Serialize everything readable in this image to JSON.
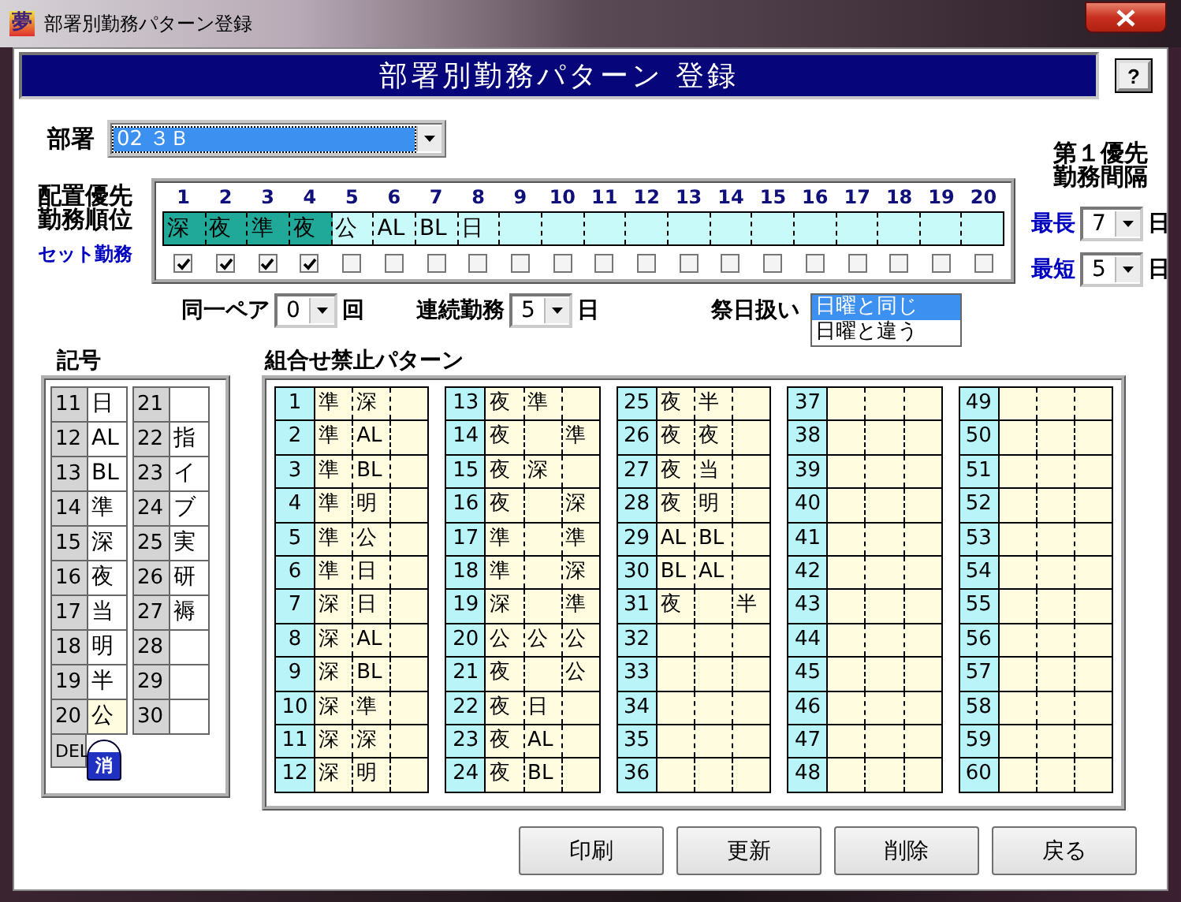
{
  "window": {
    "icon": "夢",
    "title": "部署別勤務パターン登録"
  },
  "header": {
    "title": "部署別勤務パターン 登録",
    "help": "?"
  },
  "department": {
    "label": "部署",
    "value": "02 ３Ｂ"
  },
  "priority": {
    "label_lines": [
      "配置優先",
      "勤務順位"
    ],
    "set_label": "セット勤務",
    "slots": [
      {
        "no": "1",
        "symbol": "深",
        "set": true
      },
      {
        "no": "2",
        "symbol": "夜",
        "set": true
      },
      {
        "no": "3",
        "symbol": "準",
        "set": true
      },
      {
        "no": "4",
        "symbol": "夜",
        "set": true
      },
      {
        "no": "5",
        "symbol": "公",
        "set": false
      },
      {
        "no": "6",
        "symbol": "AL",
        "set": false
      },
      {
        "no": "7",
        "symbol": "BL",
        "set": false
      },
      {
        "no": "8",
        "symbol": "日",
        "set": false
      },
      {
        "no": "9",
        "set": false
      },
      {
        "no": "10",
        "set": false
      },
      {
        "no": "11",
        "set": false
      },
      {
        "no": "12",
        "set": false
      },
      {
        "no": "13",
        "set": false
      },
      {
        "no": "14",
        "set": false
      },
      {
        "no": "15",
        "set": false
      },
      {
        "no": "16",
        "set": false
      },
      {
        "no": "17",
        "set": false
      },
      {
        "no": "18",
        "set": false
      },
      {
        "no": "19",
        "set": false
      },
      {
        "no": "20",
        "set": false
      }
    ]
  },
  "same_pair": {
    "label": "同一ペア",
    "value": "0",
    "unit": "回"
  },
  "consecutive": {
    "label": "連続勤務",
    "value": "5",
    "unit": "日"
  },
  "holiday": {
    "label": "祭日扱い",
    "options": [
      {
        "label": "日曜と同じ",
        "selected": true
      },
      {
        "label": "日曜と違う",
        "selected": false
      }
    ]
  },
  "interval": {
    "title_lines": [
      "第１優先",
      "勤務間隔"
    ],
    "rows": [
      {
        "label": "最長",
        "value": "7",
        "unit": "日"
      },
      {
        "label": "最短",
        "value": "5",
        "unit": "日"
      }
    ]
  },
  "symbols": {
    "title": "記号",
    "items": [
      {
        "no": "11",
        "symbol": "日",
        "selected": false
      },
      {
        "no": "12",
        "symbol": "AL",
        "selected": false
      },
      {
        "no": "13",
        "symbol": "BL",
        "selected": false
      },
      {
        "no": "14",
        "symbol": "準",
        "selected": false
      },
      {
        "no": "15",
        "symbol": "深",
        "selected": false
      },
      {
        "no": "16",
        "symbol": "夜",
        "selected": false
      },
      {
        "no": "17",
        "symbol": "当",
        "selected": false
      },
      {
        "no": "18",
        "symbol": "明",
        "selected": false
      },
      {
        "no": "19",
        "symbol": "半",
        "selected": false
      },
      {
        "no": "20",
        "symbol": "公",
        "selected": true
      },
      {
        "no": "21",
        "selected": false
      },
      {
        "no": "22",
        "symbol": "指",
        "selected": false
      },
      {
        "no": "23",
        "symbol": "イ",
        "selected": false
      },
      {
        "no": "24",
        "symbol": "ブ",
        "selected": false
      },
      {
        "no": "25",
        "symbol": "実",
        "selected": false
      },
      {
        "no": "26",
        "symbol": "研",
        "selected": false
      },
      {
        "no": "27",
        "symbol": "褥",
        "selected": false
      },
      {
        "no": "28",
        "selected": false
      },
      {
        "no": "29",
        "selected": false
      },
      {
        "no": "30",
        "selected": false
      }
    ],
    "delete": {
      "label": "DEL",
      "button": "消"
    }
  },
  "patterns": {
    "title": "組合せ禁止パターン",
    "rows": [
      {
        "no": "1",
        "first": "準",
        "second": "深"
      },
      {
        "no": "2",
        "first": "準",
        "second": "AL"
      },
      {
        "no": "3",
        "first": "準",
        "second": "BL"
      },
      {
        "no": "4",
        "first": "準",
        "second": "明"
      },
      {
        "no": "5",
        "first": "準",
        "second": "公"
      },
      {
        "no": "6",
        "first": "準",
        "second": "日"
      },
      {
        "no": "7",
        "first": "深",
        "second": "日"
      },
      {
        "no": "8",
        "first": "深",
        "second": "AL"
      },
      {
        "no": "9",
        "first": "深",
        "second": "BL"
      },
      {
        "no": "10",
        "first": "深",
        "second": "準"
      },
      {
        "no": "11",
        "first": "深",
        "second": "深"
      },
      {
        "no": "12",
        "first": "深",
        "second": "明"
      },
      {
        "no": "13",
        "first": "夜",
        "second": "準"
      },
      {
        "no": "14",
        "first": "夜",
        "third": "準"
      },
      {
        "no": "15",
        "first": "夜",
        "second": "深"
      },
      {
        "no": "16",
        "first": "夜",
        "third": "深"
      },
      {
        "no": "17",
        "first": "準",
        "third": "準"
      },
      {
        "no": "18",
        "first": "準",
        "third": "深"
      },
      {
        "no": "19",
        "first": "深",
        "third": "準"
      },
      {
        "no": "20",
        "first": "公",
        "second": "公",
        "third": "公"
      },
      {
        "no": "21",
        "first": "夜",
        "third": "公"
      },
      {
        "no": "22",
        "first": "夜",
        "second": "日"
      },
      {
        "no": "23",
        "first": "夜",
        "second": "AL"
      },
      {
        "no": "24",
        "first": "夜",
        "second": "BL"
      },
      {
        "no": "25",
        "first": "夜",
        "second": "半"
      },
      {
        "no": "26",
        "first": "夜",
        "second": "夜"
      },
      {
        "no": "27",
        "first": "夜",
        "second": "当"
      },
      {
        "no": "28",
        "first": "夜",
        "second": "明"
      },
      {
        "no": "29",
        "first": "AL",
        "second": "BL"
      },
      {
        "no": "30",
        "first": "BL",
        "second": "AL"
      },
      {
        "no": "31",
        "first": "夜",
        "third": "半"
      },
      {
        "no": "32"
      },
      {
        "no": "33"
      },
      {
        "no": "34"
      },
      {
        "no": "35"
      },
      {
        "no": "36"
      },
      {
        "no": "37"
      },
      {
        "no": "38"
      },
      {
        "no": "39"
      },
      {
        "no": "40"
      },
      {
        "no": "41"
      },
      {
        "no": "42"
      },
      {
        "no": "43"
      },
      {
        "no": "44"
      },
      {
        "no": "45"
      },
      {
        "no": "46"
      },
      {
        "no": "47"
      },
      {
        "no": "48"
      },
      {
        "no": "49"
      },
      {
        "no": "50"
      },
      {
        "no": "51"
      },
      {
        "no": "52"
      },
      {
        "no": "53"
      },
      {
        "no": "54"
      },
      {
        "no": "55"
      },
      {
        "no": "56"
      },
      {
        "no": "57"
      },
      {
        "no": "58"
      },
      {
        "no": "59"
      },
      {
        "no": "60"
      }
    ]
  },
  "buttons": [
    "印刷",
    "更新",
    "削除",
    "戻る"
  ]
}
